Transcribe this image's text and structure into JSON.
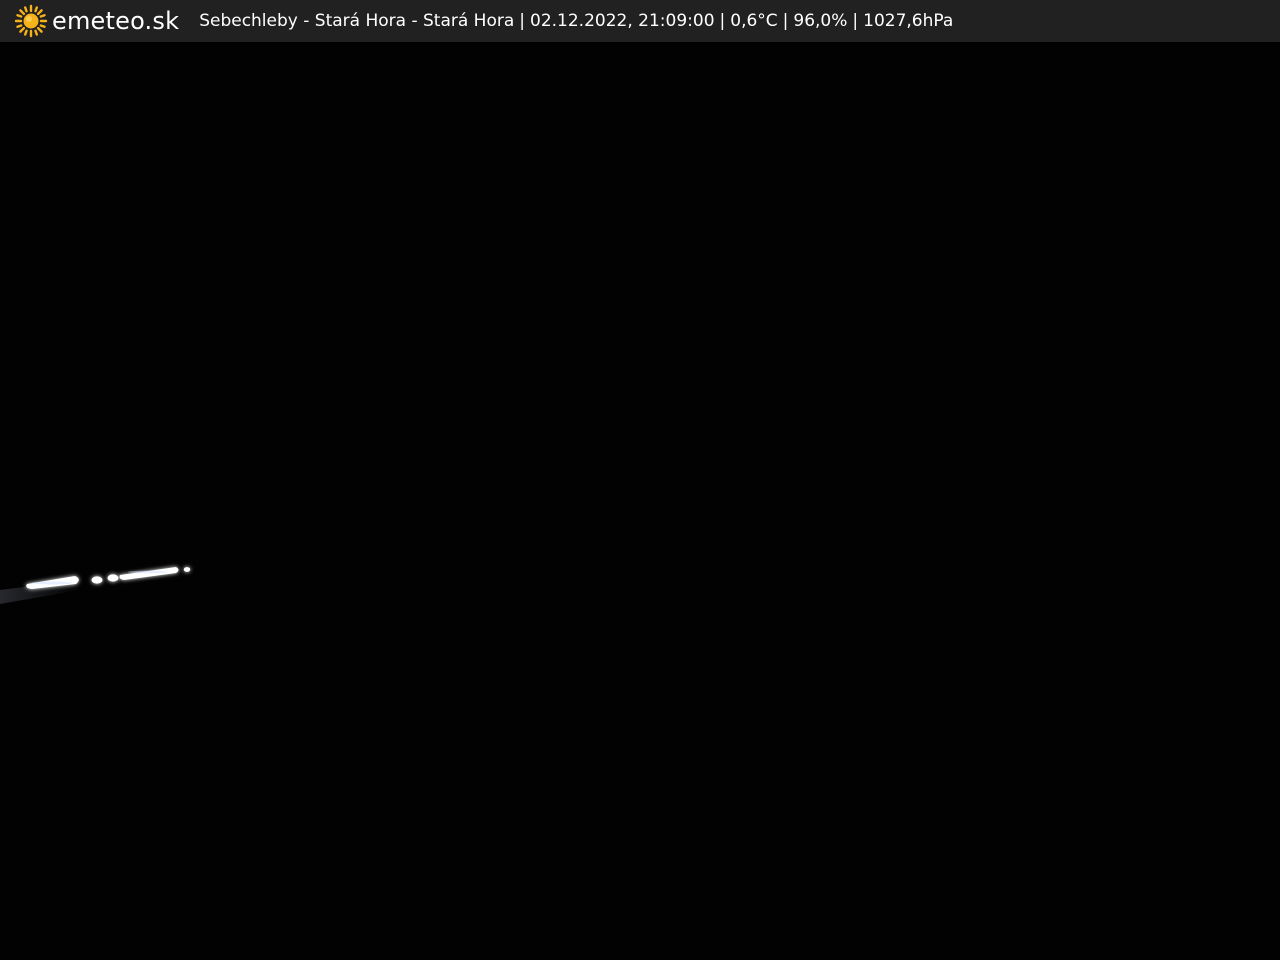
{
  "header": {
    "logo_icon": "sun-icon",
    "brand": "emeteo.sk",
    "location": "Sebechleby - Stará Hora - Stará Hora",
    "datetime": "02.12.2022, 21:09:00",
    "temperature": "0,6°C",
    "humidity": "96,0%",
    "pressure": "1027,6hPa",
    "separator": "|"
  },
  "colors": {
    "bar_background": "#212121",
    "sky": "#020202",
    "sun": "#f6b21a",
    "lights": "#ffffff"
  }
}
